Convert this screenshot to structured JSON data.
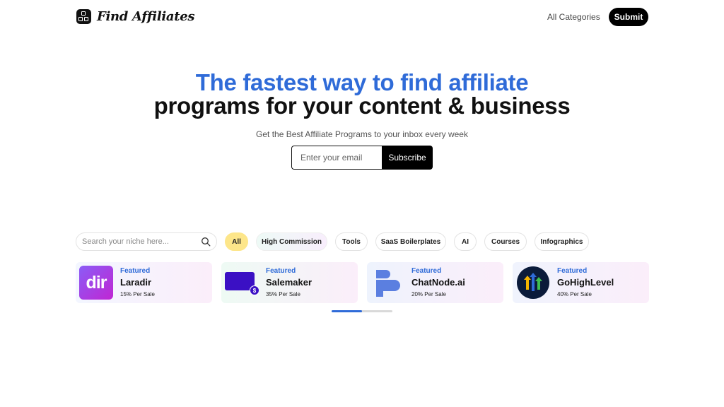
{
  "header": {
    "logo_text": "Find Affiliates",
    "nav_link": "All Categories",
    "submit_label": "Submit"
  },
  "hero": {
    "title_line1": "The fastest way to find affiliate",
    "title_line2": "programs for your content & business",
    "subtitle": "Get the Best Affiliate Programs to your inbox every week",
    "email_placeholder": "Enter your email",
    "subscribe_label": "Subscribe"
  },
  "filters": {
    "search_placeholder": "Search your niche here...",
    "chips": [
      "All",
      "High Commission",
      "Tools",
      "SaaS Boilerplates",
      "AI",
      "Courses",
      "Infographics"
    ],
    "active_chip": "All"
  },
  "cards": [
    {
      "badge": "Featured",
      "name": "Laradir",
      "rate": "15% Per Sale",
      "logo_text": "dir"
    },
    {
      "badge": "Featured",
      "name": "Salemaker",
      "rate": "35% Per Sale",
      "logo_text": "$"
    },
    {
      "badge": "Featured",
      "name": "ChatNode.ai",
      "rate": "20% Per Sale"
    },
    {
      "badge": "Featured",
      "name": "GoHighLevel",
      "rate": "40% Per Sale"
    }
  ],
  "carousel": {
    "progress": 0.5
  },
  "colors": {
    "accent": "#2f6bd8",
    "active_chip": "#fde68a",
    "dark": "#000000"
  }
}
